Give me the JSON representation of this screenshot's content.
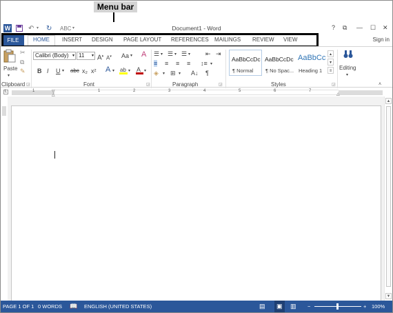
{
  "annotation": {
    "label": "Menu bar"
  },
  "titlebar": {
    "title": "Document1 - Word",
    "help": "?",
    "restore": "⧉",
    "minimize": "—",
    "maximize": "☐",
    "close": "✕"
  },
  "tabs": {
    "file": "FILE",
    "items": [
      "HOME",
      "INSERT",
      "DESIGN",
      "PAGE LAYOUT",
      "REFERENCES",
      "MAILINGS",
      "REVIEW",
      "VIEW"
    ],
    "active": "HOME",
    "signin": "Sign in"
  },
  "ribbon": {
    "clipboard": {
      "label": "Clipboard",
      "paste": "Paste"
    },
    "font": {
      "label": "Font",
      "font_name": "Calibri (Body)",
      "font_size": "11",
      "case": "Aa",
      "bold": "B",
      "italic": "I",
      "underline": "U",
      "strike": "abc",
      "subscript": "x₂",
      "superscript": "x²"
    },
    "paragraph": {
      "label": "Paragraph",
      "pilcrow": "¶"
    },
    "styles": {
      "label": "Styles",
      "items": [
        {
          "sample": "AaBbCcDc",
          "name": "¶ Normal"
        },
        {
          "sample": "AaBbCcDc",
          "name": "¶ No Spac..."
        },
        {
          "sample": "AaBbCc",
          "name": "Heading 1"
        }
      ]
    },
    "editing": {
      "label": "Editing"
    }
  },
  "ruler": {
    "numbers": [
      "1",
      "1",
      "2",
      "3",
      "4",
      "5",
      "6",
      "7"
    ]
  },
  "statusbar": {
    "page": "PAGE 1 OF 1",
    "words": "0 WORDS",
    "language": "ENGLISH (UNITED STATES)",
    "zoom": "100%",
    "zoom_level": 1.0
  },
  "colors": {
    "word_blue": "#2b579a",
    "highlight_yellow": "#ffff00",
    "font_red": "#c00000"
  }
}
